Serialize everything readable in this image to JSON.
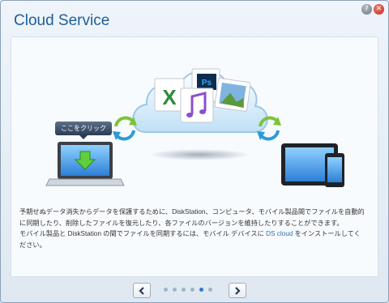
{
  "window": {
    "title": "Cloud Service",
    "help_icon": "help-icon",
    "close_icon": "close-icon",
    "accent_color": "#1f5e99"
  },
  "illustration": {
    "tooltip_label": "ここをクリック",
    "icons": [
      "laptop-icon",
      "sync-icon",
      "cloud-icon",
      "excel-file-icon",
      "photoshop-file-icon",
      "music-file-icon",
      "image-file-icon",
      "tablet-icon",
      "phone-icon"
    ]
  },
  "description": {
    "para1": "予期せぬデータ消失からデータを保護するために、DiskStation、コンピュータ、モバイル製品間でファイルを自動的に同期したり、削除したファイルを復元したり、各ファイルのバージョンを維持したりすることができます。",
    "para2_prefix": "モバイル製品と DiskStation の間でファイルを同期するには、モバイル デバイスに ",
    "para2_link": "DS cloud",
    "para2_suffix": " をインストールしてください。"
  },
  "pager": {
    "prev_icon": "chevron-left-icon",
    "next_icon": "chevron-right-icon",
    "total_pages": 6,
    "current_page": 5,
    "active_color": "#2c7ad0"
  }
}
